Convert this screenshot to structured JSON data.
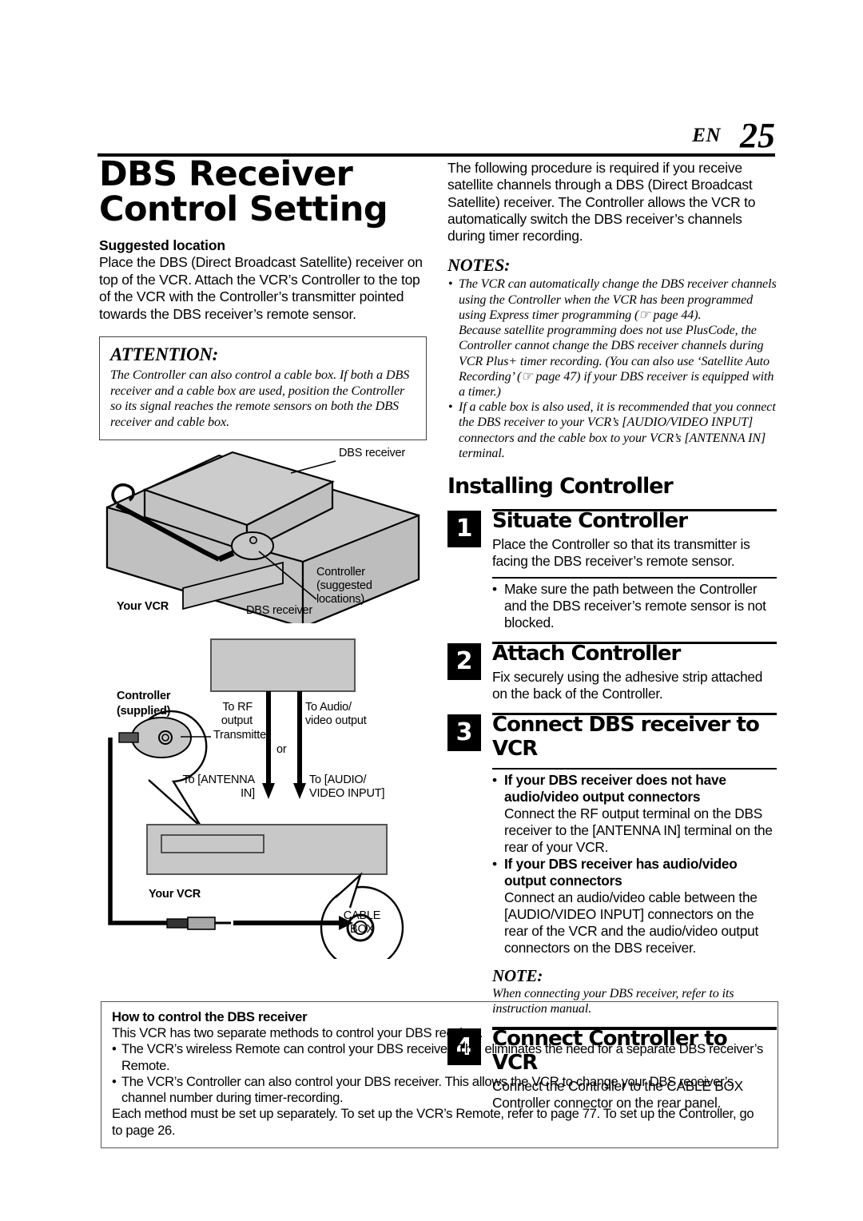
{
  "header": {
    "lang": "EN",
    "page_number": "25"
  },
  "left": {
    "title_line1": "DBS Receiver",
    "title_line2": "Control Setting",
    "suggested_heading": "Suggested location",
    "suggested_body": "Place the DBS (Direct Broadcast Satellite) receiver on top of the VCR. Attach the VCR’s Controller to the top of the VCR with the Controller’s transmitter pointed towards the DBS receiver’s remote sensor.",
    "attention_heading": "ATTENTION:",
    "attention_body": "The Controller can also control a cable box. If both a DBS receiver and a cable box are used, position the Controller so its signal reaches the remote sensors on both the DBS receiver and cable box."
  },
  "right": {
    "intro": "The following procedure is required if you receive satellite channels through a DBS (Direct Broadcast Satellite) receiver. The Controller allows the VCR to automatically switch the DBS receiver’s channels during timer recording.",
    "notes_heading": "NOTES:",
    "notes": [
      "The VCR can automatically change the DBS receiver channels using the Controller when the VCR has been programmed using Express timer programming (☞  page 44).",
      "Because satellite programming does not use PlusCode, the Controller cannot change the DBS receiver channels during VCR Plus+ timer recording. (You can also use ‘Satellite Auto Recording’ (☞  page 47) if your DBS receiver is equipped with a timer.)",
      "If a cable box is also used, it is recommended that you connect the DBS receiver to your VCR’s [AUDIO/VIDEO INPUT] connectors and the cable box to your VCR’s [ANTENNA IN] terminal."
    ],
    "section_title": "Installing Controller",
    "steps": [
      {
        "num": "1",
        "title": "Situate Controller",
        "body": "Place the Controller so that its transmitter is facing the DBS receiver’s remote sensor.",
        "bullets": [
          "Make sure the path between the Controller and the DBS receiver’s remote sensor is not blocked."
        ]
      },
      {
        "num": "2",
        "title": "Attach Controller",
        "body": "Fix securely using the adhesive strip attached on the back of the Controller.",
        "bullets": []
      },
      {
        "num": "3",
        "title": "Connect DBS receiver to VCR",
        "body": "",
        "bullet_head_1": "If your DBS receiver does not have audio/video output connectors",
        "bullet_body_1": "Connect the RF output terminal on the DBS receiver to the [ANTENNA IN] terminal on the rear of your VCR.",
        "bullet_head_2": "If your DBS receiver has audio/video output connectors",
        "bullet_body_2": "Connect an audio/video cable between the [AUDIO/VIDEO INPUT] connectors on the rear of the VCR and the audio/video output connectors on the DBS receiver.",
        "note_heading": "NOTE:",
        "note_body": "When connecting your DBS receiver, refer to its instruction manual."
      },
      {
        "num": "4",
        "title": "Connect Controller to VCR",
        "body": "Connect the Controller to the CABLE BOX Controller connector on the rear panel.",
        "bullets": []
      }
    ]
  },
  "bottom_box": {
    "heading": "How to control the DBS receiver",
    "intro": "This VCR has two separate methods to control your DBS receiver.",
    "bullets": [
      "The VCR’s wireless Remote can control your DBS receiver. This eliminates the need for a separate DBS receiver’s Remote.",
      "The VCR’s Controller can also control your DBS receiver. This allows the VCR to change your DBS receiver’s channel number during timer-recording."
    ],
    "closing": "Each method must be set up separately. To set up the VCR’s Remote, refer to page 77. To set up the Controller, go to page 26."
  },
  "diagram": {
    "labels": {
      "dbs_receiver_top": "DBS receiver",
      "controller_suggested": "Controller\n(suggested\nlocations)",
      "controller_suggested_l1": "Controller",
      "controller_suggested_l2": "(suggested",
      "controller_suggested_l3": "locations)",
      "your_vcr_top": "Your VCR",
      "dbs_receiver_mid": "DBS receiver",
      "controller_supplied_l1": "Controller",
      "controller_supplied_l2": "(supplied)",
      "transmitter": "Transmitter",
      "to_rf_l1": "To RF",
      "to_rf_l2": "output",
      "to_audio_l1": "To Audio/",
      "to_audio_l2": "video output",
      "or": "or",
      "to_antenna_l1": "To [ANTENNA",
      "to_antenna_l2": "IN]",
      "to_av_l1": "To [AUDIO/",
      "to_av_l2": "VIDEO INPUT]",
      "your_vcr_bottom": "Your VCR",
      "cable_box_l1": "CABLE",
      "cable_box_l2": "BOX"
    },
    "colors": {
      "device_fill": "#c8c8c8",
      "stroke": "#000000"
    }
  }
}
